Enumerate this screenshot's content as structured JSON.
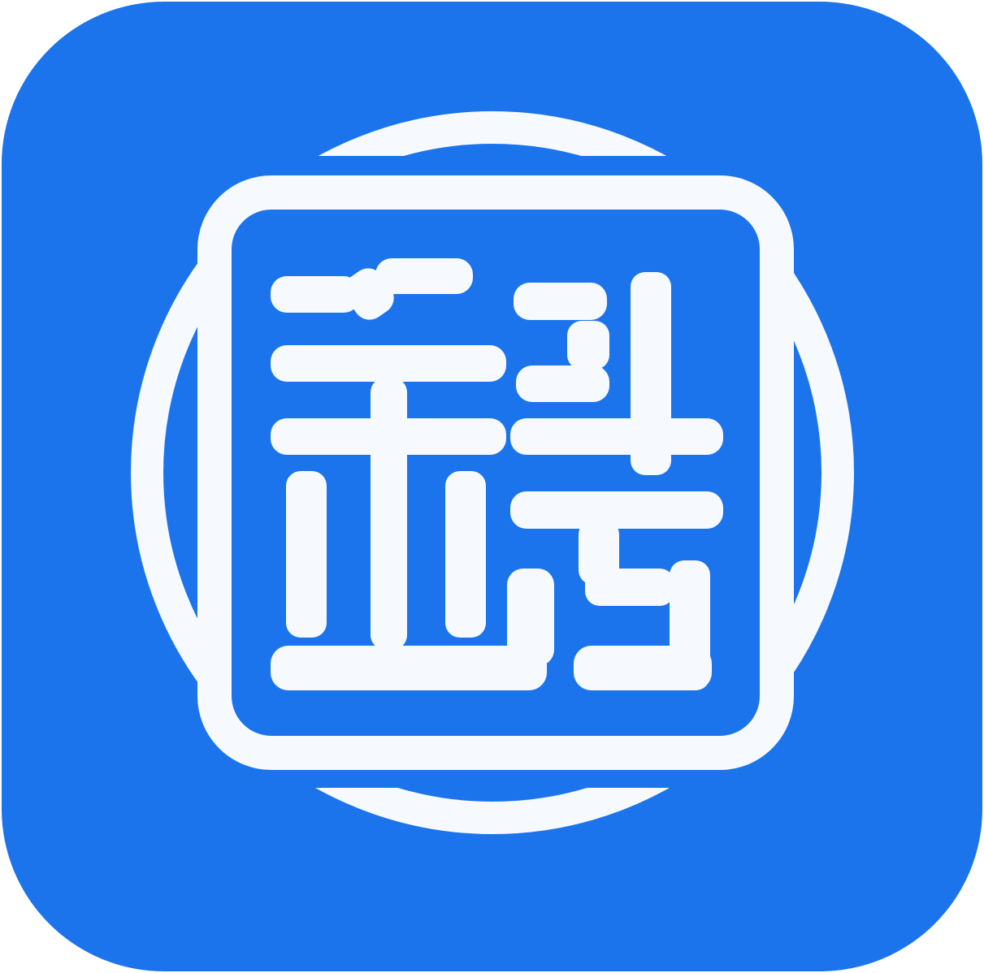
{
  "icon": {
    "name": "qian-seal-app-icon",
    "glyph": "钱",
    "colors": {
      "background": "#1B74EC",
      "foreground": "#FFFFFF"
    }
  }
}
